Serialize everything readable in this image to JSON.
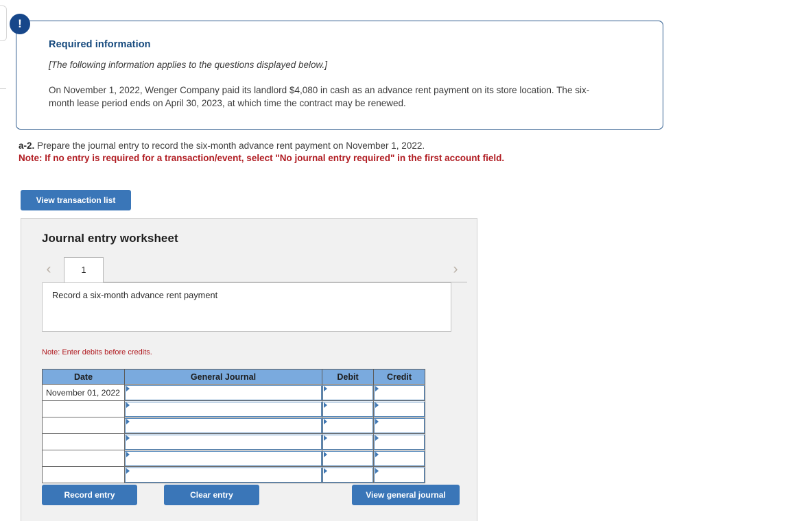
{
  "callout": {
    "icon": "exclamation-icon",
    "title": "Required information",
    "italic_note": "[The following information applies to the questions displayed below.]",
    "body": "On November 1, 2022, Wenger Company paid its landlord $4,080 in cash as an advance rent payment on its store location. The six-month lease period ends on April 30, 2023, at which time the contract may be renewed."
  },
  "question": {
    "label": "a-2.",
    "text": "Prepare the journal entry to record the six-month advance rent payment on November 1, 2022.",
    "note": "Note: If no entry is required for a transaction/event, select \"No journal entry required\" in the first account field."
  },
  "toolbar": {
    "view_transaction_list": "View transaction list"
  },
  "worksheet": {
    "title": "Journal entry worksheet",
    "prev_icon": "chevron-left-icon",
    "next_icon": "chevron-right-icon",
    "tabs": [
      {
        "label": "1",
        "active": true
      }
    ],
    "description": "Record a six-month advance rent payment",
    "note": "Note: Enter debits before credits.",
    "table": {
      "columns": [
        "Date",
        "General Journal",
        "Debit",
        "Credit"
      ],
      "rows": [
        {
          "date": "November 01, 2022",
          "general_journal": "",
          "debit": "",
          "credit": ""
        },
        {
          "date": "",
          "general_journal": "",
          "debit": "",
          "credit": ""
        },
        {
          "date": "",
          "general_journal": "",
          "debit": "",
          "credit": ""
        },
        {
          "date": "",
          "general_journal": "",
          "debit": "",
          "credit": ""
        },
        {
          "date": "",
          "general_journal": "",
          "debit": "",
          "credit": ""
        },
        {
          "date": "",
          "general_journal": "",
          "debit": "",
          "credit": ""
        }
      ]
    },
    "actions": {
      "record_entry": "Record entry",
      "clear_entry": "Clear entry",
      "view_general_journal": "View general journal"
    }
  },
  "colors": {
    "accent_blue": "#3a76b8",
    "callout_border": "#2c5a8c",
    "callout_title": "#15497d",
    "badge": "#17478a",
    "warning_red": "#b01b21",
    "table_header": "#7aaade",
    "panel_bg": "#f1f1f1"
  }
}
